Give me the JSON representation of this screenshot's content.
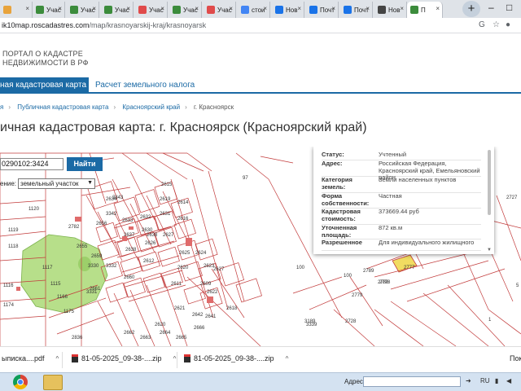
{
  "browser": {
    "tabs": [
      {
        "label": "",
        "icon_color": "#e8a33c"
      },
      {
        "label": "Учас",
        "icon_color": "#3c8c3c"
      },
      {
        "label": "Учас",
        "icon_color": "#3c8c3c"
      },
      {
        "label": "Учас",
        "icon_color": "#3c8c3c"
      },
      {
        "label": "Учас",
        "icon_color": "#e04b4b"
      },
      {
        "label": "Учас",
        "icon_color": "#3c8c3c"
      },
      {
        "label": "Учас",
        "icon_color": "#e04b4b"
      },
      {
        "label": "стои",
        "icon_color": "#4285f4"
      },
      {
        "label": "Нов",
        "icon_color": "#1a73e8"
      },
      {
        "label": "Почт",
        "icon_color": "#1a73e8"
      },
      {
        "label": "Почт",
        "icon_color": "#1a73e8"
      },
      {
        "label": "Нов",
        "icon_color": "#444444"
      },
      {
        "label": "П",
        "icon_color": "#3c8c3c"
      }
    ],
    "new_tab": "+",
    "url_domain": "ik10map.roscadastres.com",
    "url_path": "/map/krasnoyarskij-kraj/krasnoyarsk"
  },
  "site": {
    "title_line1": "ПОРТАЛ О КАДАСТРЕ",
    "title_line2": "НЕДВИЖИМОСТИ В РФ",
    "nav_active": "ная кадастровая карта",
    "nav_link": "Расчет земельного налога",
    "breadcrumbs": [
      "я",
      "Публичная кадастровая карта",
      "Красноярский край"
    ],
    "breadcrumb_current": "г. Красноярск",
    "heading": "ичная кадастровая карта: г. Красноярск (Красноярский край)"
  },
  "map": {
    "search_value": "0290102:3424",
    "search_button": "Найти",
    "select_label": "ение:",
    "select_value": "земельный участок",
    "popup": [
      {
        "label": "Статус:",
        "value": "Учтенный"
      },
      {
        "label": "Адрес:",
        "value": "Российская Федерация, Красноярский край, Емельяновский район"
      },
      {
        "label": "Категория земель:",
        "value": "Земли населенных пунктов"
      },
      {
        "label": "Форма собственности:",
        "value": "Частная"
      },
      {
        "label": "Кадастровая стоимость:",
        "value": "373669.44 руб"
      },
      {
        "label": "Уточненная площадь:",
        "value": "872 кв.м"
      },
      {
        "label": "Разрешенное",
        "value": "Для индивидуального жилищного"
      }
    ],
    "parcel_labels": [
      "97",
      "1120",
      "1119",
      "1118",
      "1117",
      "1116",
      "1115",
      "1166",
      "1175",
      "1174",
      "2782",
      "2634",
      "2633",
      "2632",
      "2631",
      "2630",
      "2637",
      "2638",
      "2626",
      "2625",
      "2627",
      "2620",
      "2619",
      "2616",
      "2615",
      "2614",
      "2612",
      "2611",
      "2609",
      "2624",
      "2623",
      "2622",
      "2621",
      "2620",
      "2618",
      "2656",
      "2655",
      "2659",
      "2660",
      "2661",
      "2662",
      "2663",
      "2664",
      "2665",
      "2666",
      "2642",
      "2641",
      "3342",
      "3343",
      "3331",
      "3330",
      "3332",
      "2836",
      "2638",
      "2627",
      "2789",
      "2788",
      "2779",
      "2778",
      "2777",
      "2727",
      "100",
      "100",
      "3339",
      "3189",
      "2728",
      "1",
      "5"
    ]
  },
  "downloads": [
    {
      "name": "ыписка....pdf",
      "chevron": "^"
    },
    {
      "name": "81-05-2025_09-38-....zip",
      "chevron": "^"
    },
    {
      "name": "81-05-2025_09-38-....zip",
      "chevron": "^"
    }
  ],
  "downloads_show": "Пок",
  "taskbar": {
    "addr_label": "Адрес",
    "lang": "RU",
    "colors": {
      "bg": "#d4e2f1"
    }
  },
  "colors": {
    "accent": "#1b6aa5",
    "parcel_line": "#c23b3b",
    "green_zone": "#b7df8a",
    "selected_parcel": "#f1dc61"
  }
}
